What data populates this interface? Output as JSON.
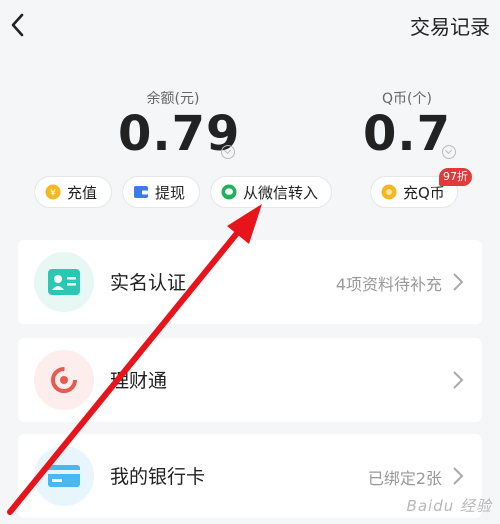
{
  "header": {
    "title": "交易记录",
    "back_icon": "chevron-left-icon"
  },
  "balance": {
    "label": "余额(元)",
    "value": "0.79"
  },
  "qcoin": {
    "label": "Q币(个)",
    "value": "0.7"
  },
  "actions": {
    "recharge": "充值",
    "withdraw": "提现",
    "wechat_transfer": "从微信转入",
    "buy_qcoin": "充Q币",
    "qcoin_badge": "97折"
  },
  "menu": [
    {
      "label": "实名认证",
      "sub": "4项资料待补充",
      "icon": "id-card-icon"
    },
    {
      "label": "理财通",
      "sub": "",
      "icon": "licaitong-icon"
    },
    {
      "label": "我的银行卡",
      "sub": "已绑定2张",
      "icon": "bank-card-icon"
    }
  ],
  "colors": {
    "accent_red": "#e23a3a",
    "coin_gold": "#f2b722",
    "wallet_blue": "#3d7be8",
    "wechat_green": "#1fb25a",
    "idcard_teal": "#2cc7b2",
    "bankcard_blue": "#49b8f0"
  },
  "watermark": "Baidu 经验"
}
